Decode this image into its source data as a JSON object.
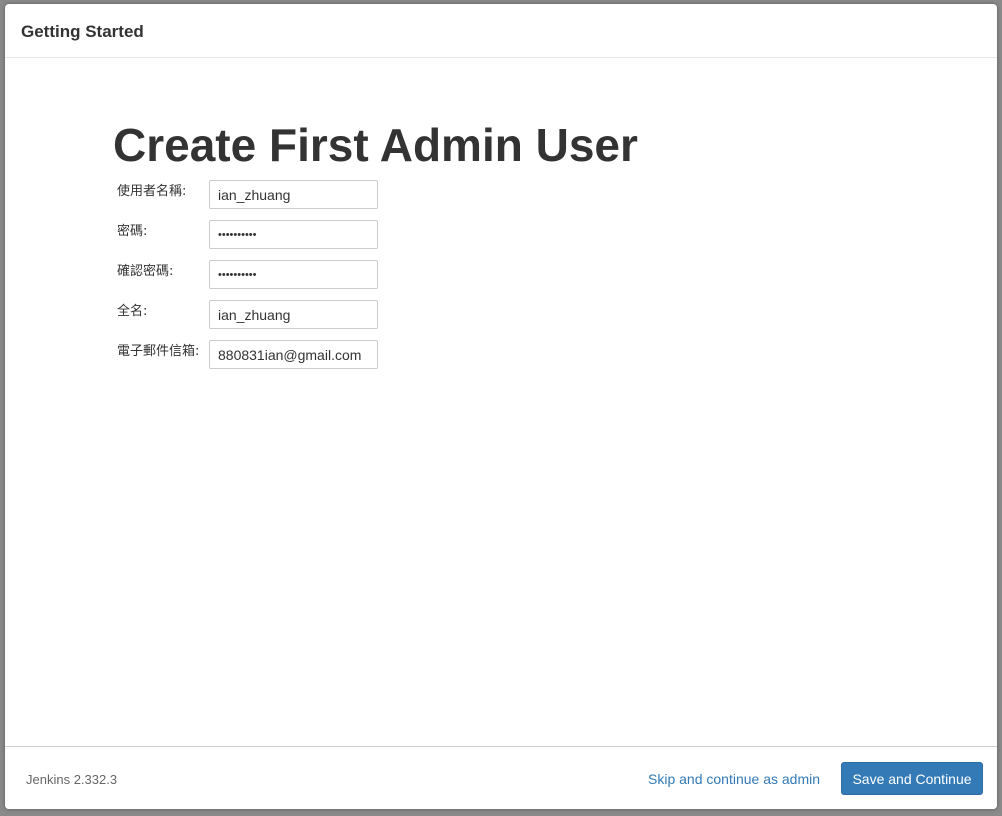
{
  "header": {
    "title": "Getting Started"
  },
  "main": {
    "heading": "Create First Admin User",
    "fields": [
      {
        "label": "使用者名稱:",
        "type": "text",
        "value": "ian_zhuang"
      },
      {
        "label": "密碼:",
        "type": "password",
        "value": "••••••••••"
      },
      {
        "label": "確認密碼:",
        "type": "password",
        "value": "••••••••••"
      },
      {
        "label": "全名:",
        "type": "text",
        "value": "ian_zhuang"
      },
      {
        "label": "電子郵件信箱:",
        "type": "text",
        "value": "880831ian@gmail.com"
      }
    ]
  },
  "footer": {
    "version": "Jenkins 2.332.3",
    "skip_label": "Skip and continue as admin",
    "save_label": "Save and Continue"
  },
  "colors": {
    "accent": "#337ab7",
    "text": "#333333",
    "backdrop": "#8a8a8a"
  }
}
